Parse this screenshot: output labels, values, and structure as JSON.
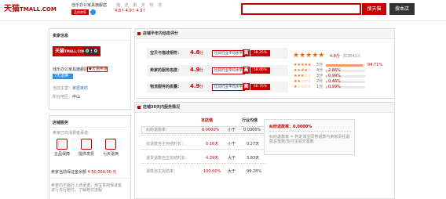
{
  "header": {
    "logo_main": "天猫",
    "logo_sub": "TMALL.COM",
    "shop_name": "佳乐办公家具旗舰店",
    "shop_badge": "品质商家",
    "dsr_labels": [
      "描",
      "述",
      "服",
      "务",
      "物",
      "流"
    ],
    "dsr_values": [
      "4.8",
      "4.9",
      "4.9"
    ],
    "search_placeholder": "",
    "btn_tmall": "搜天猫",
    "btn_shop": "搜本店"
  },
  "sidebar": {
    "info_title": "卖家信息",
    "tmall_badge": "天猫",
    "tmall_badge_sub": "TMALL.COM",
    "tmall_score": "0 : 0",
    "shop_name": "佳乐办公家具旗舰店",
    "tag1": "天猫卖家",
    "tag2": "7天退换",
    "company_label": "当前主营：",
    "company_value": "家居家纺",
    "location_label": "所在地区：",
    "location_value": "中山",
    "svc_title": "店铺服务",
    "svc_desc": "卖家已向消费者承诺：",
    "svc_items": [
      "正品保障",
      "提供发票",
      "七天退换"
    ],
    "deposit_label": "卖家当前保证金余额",
    "deposit_value": "¥ 50,000.00 元",
    "note": "卖家向不履行上述承诺，淘宝将用保证金进行先行赔付。了解赔付流程"
  },
  "dsr": {
    "title": "店铺半年内动态评分",
    "compare_label": "比同行业平均水平",
    "hi_label": "高",
    "rows": [
      {
        "label": "宝贝与描述相符：",
        "score": "4.8",
        "unit": "分",
        "pct": "38.25%"
      },
      {
        "label": "卖家的服务态度：",
        "score": "4.9",
        "unit": "分",
        "pct": "58.00%"
      },
      {
        "label": "物流服务的质量：",
        "score": "4.9",
        "unit": "分",
        "pct": "60.76%"
      }
    ],
    "summary_score": "4.8分",
    "summary_count": "共3041人",
    "dist": [
      {
        "label": "5分",
        "pct": "94.71%",
        "value": 94.71
      },
      {
        "label": "4分",
        "pct": "2.86%",
        "value": 2.86
      },
      {
        "label": "3分",
        "pct": "0.99%",
        "value": 0.99
      },
      {
        "label": "2分",
        "pct": "0.46%",
        "value": 0.46
      },
      {
        "label": "1分",
        "pct": "0.99%",
        "value": 0.99
      }
    ]
  },
  "service": {
    "title": "店铺30天内服务情况",
    "col_shop": "本店值",
    "col_avg": "行业均值",
    "rows": [
      {
        "label": "纠纷退款率：",
        "shop": "0.0000%",
        "cmp": "小于",
        "avg": "0.0300%"
      },
      {
        "label": "仅退款自主完结时长：",
        "shop": "0.16天",
        "cmp": "小于",
        "avg": "0.27天"
      },
      {
        "label": "退货退款自主完结时长：",
        "shop": "4.39天",
        "cmp": "大于",
        "avg": "3.83天"
      },
      {
        "label": "退款自主完结率：",
        "shop": "100.00%",
        "cmp": "大于",
        "avg": "99.28%"
      }
    ],
    "summary_title": "纠纷退款率：",
    "summary_value": "0.0000%",
    "summary_desc": "纠纷退款率 = 判定淘宝同意退款与卖家责任退款总笔数/支付宝成交笔数"
  }
}
